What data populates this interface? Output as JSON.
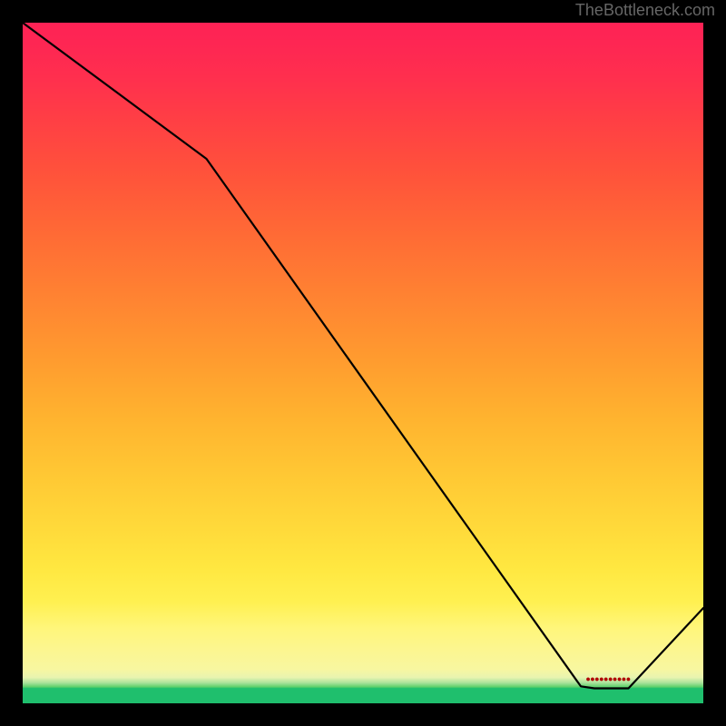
{
  "attribution": "TheBottleneck.com",
  "chart_data": {
    "type": "line",
    "title": "",
    "xlabel": "",
    "ylabel": "",
    "xlim": [
      0,
      1
    ],
    "ylim": [
      0,
      1
    ],
    "x": [
      0.0,
      0.27,
      0.82,
      0.84,
      0.89,
      1.0
    ],
    "values": [
      1.0,
      0.8,
      0.025,
      0.022,
      0.022,
      0.14
    ],
    "hotspot": {
      "x": 0.86,
      "y": 0.035,
      "label": "●●●●●●●●●●"
    }
  },
  "colors": {
    "line": "#000000",
    "hotspot": "#b00000",
    "frame": "#000000"
  }
}
